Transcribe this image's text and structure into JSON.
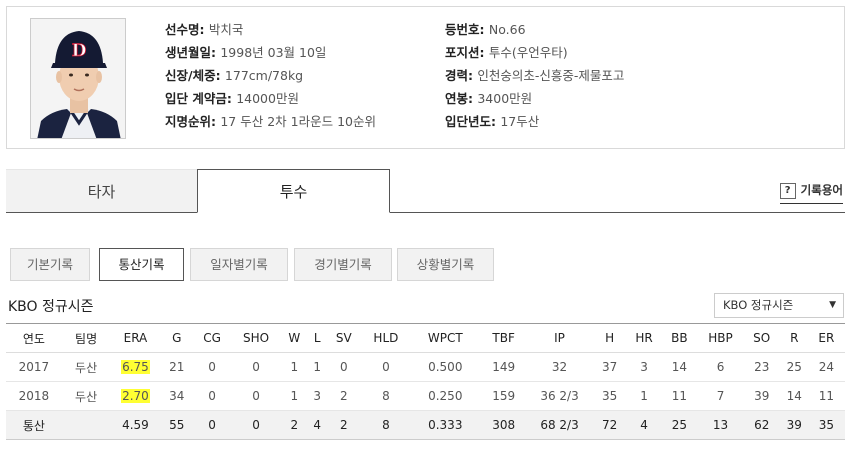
{
  "player": {
    "rows_left": [
      {
        "label": "선수명: ",
        "value": "박치국"
      },
      {
        "label": "생년월일: ",
        "value": "1998년 03월 10일"
      },
      {
        "label": "신장/체중: ",
        "value": "177cm/78kg"
      },
      {
        "label": "입단 계약금: ",
        "value": "14000만원"
      },
      {
        "label": "지명순위: ",
        "value": "17 두산 2차 1라운드 10순위"
      }
    ],
    "rows_right": [
      {
        "label": "등번호: ",
        "value": "No.66"
      },
      {
        "label": "포지션: ",
        "value": "투수(우언우타)"
      },
      {
        "label": "경력: ",
        "value": "인천숭의초-신흥중-제물포고"
      },
      {
        "label": "연봉: ",
        "value": "3400만원"
      },
      {
        "label": "입단년도: ",
        "value": "17두산"
      }
    ],
    "cap_letter": "D"
  },
  "main_tabs": {
    "batter": "타자",
    "pitcher": "투수",
    "glossary_icon": "?",
    "glossary": "기록용어"
  },
  "sub_tabs": [
    "기본기록",
    "통산기록",
    "일자별기록",
    "경기별기록",
    "상황별기록"
  ],
  "section": {
    "title": "KBO 정규시즌",
    "select_value": "KBO 정규시즌",
    "select_arrow": "▼"
  },
  "table": {
    "headers": [
      "연도",
      "팀명",
      "ERA",
      "G",
      "CG",
      "SHO",
      "W",
      "L",
      "SV",
      "HLD",
      "WPCT",
      "TBF",
      "IP",
      "H",
      "HR",
      "BB",
      "HBP",
      "SO",
      "R",
      "ER"
    ],
    "rows": [
      [
        "2017",
        "두산",
        "6.75",
        "21",
        "0",
        "0",
        "1",
        "1",
        "0",
        "0",
        "0.500",
        "149",
        "32",
        "37",
        "3",
        "14",
        "6",
        "23",
        "25",
        "24"
      ],
      [
        "2018",
        "두산",
        "2.70",
        "34",
        "0",
        "0",
        "1",
        "3",
        "2",
        "8",
        "0.250",
        "159",
        "36 2/3",
        "35",
        "1",
        "11",
        "7",
        "39",
        "14",
        "11"
      ]
    ],
    "total": [
      "통산",
      "",
      "4.59",
      "55",
      "0",
      "0",
      "2",
      "4",
      "2",
      "8",
      "0.333",
      "308",
      "68 2/3",
      "72",
      "4",
      "25",
      "13",
      "62",
      "39",
      "35"
    ],
    "highlight_color": "#ffff33"
  }
}
